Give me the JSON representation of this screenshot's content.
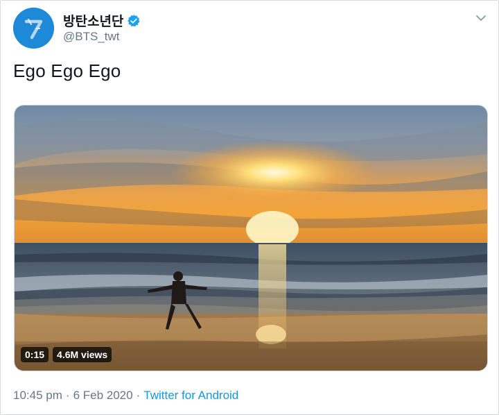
{
  "author": {
    "display_name": "방탄소년단",
    "handle": "@BTS_twt",
    "verified": true,
    "avatar_icon": "bts-seven-logo"
  },
  "tweet": {
    "text": "Ego Ego Ego"
  },
  "video": {
    "duration": "0:15",
    "views": "4.6M views"
  },
  "meta": {
    "time": "10:45 pm",
    "separator_1": "·",
    "date": "6 Feb 2020",
    "separator_2": "·",
    "source": "Twitter for Android"
  },
  "colors": {
    "link": "#1b95e0",
    "verified": "#1da1f2",
    "muted": "#657786"
  }
}
